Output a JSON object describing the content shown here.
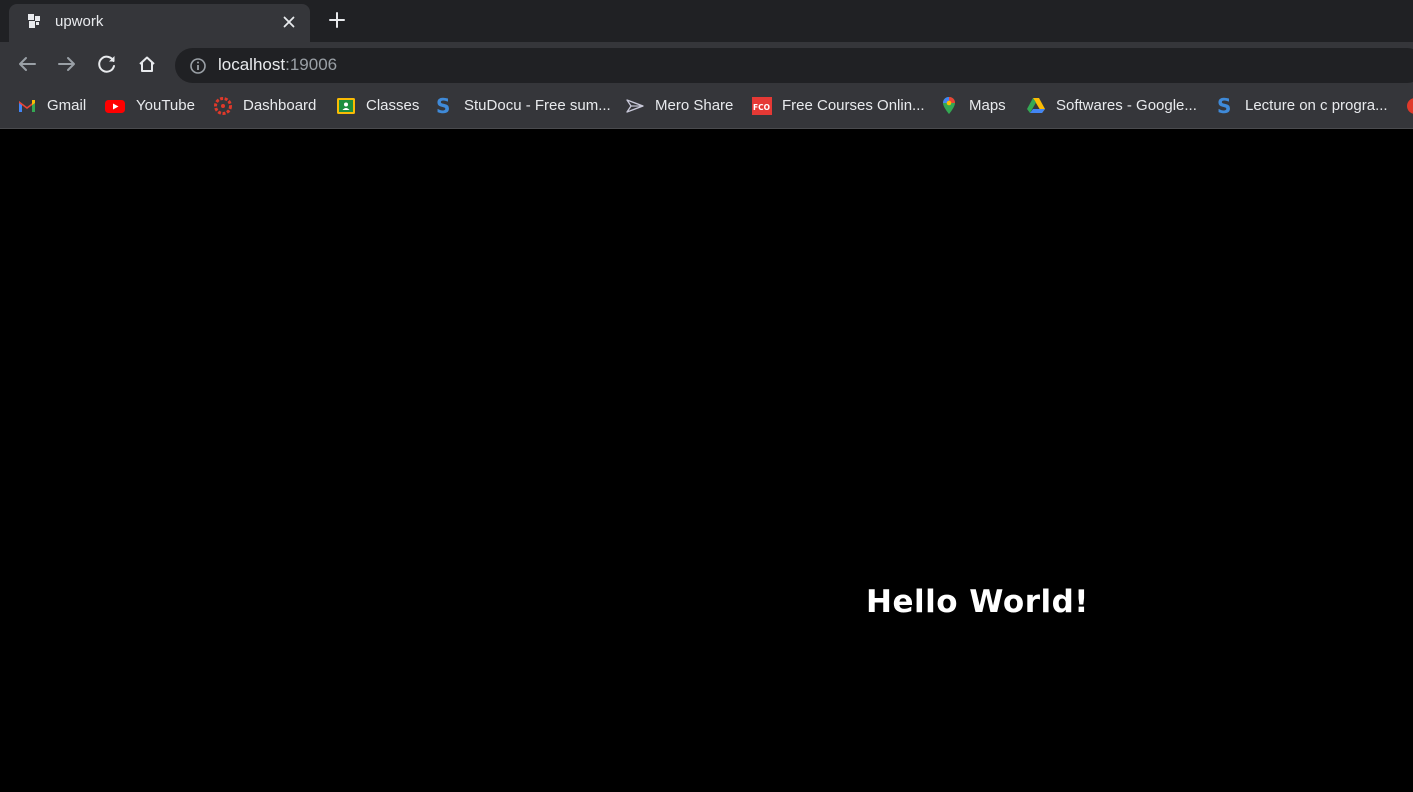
{
  "tab": {
    "title": "upwork",
    "favicon": "upwork-icon"
  },
  "omnibox": {
    "host": "localhost",
    "port": ":19006"
  },
  "bookmarks": [
    {
      "label": "Gmail",
      "icon": "gmail-icon"
    },
    {
      "label": "YouTube",
      "icon": "youtube-icon"
    },
    {
      "label": "Dashboard",
      "icon": "dashboard-icon"
    },
    {
      "label": "Classes",
      "icon": "classes-icon"
    },
    {
      "label": "StuDocu - Free sum...",
      "icon": "studocu-icon"
    },
    {
      "label": "Mero Share",
      "icon": "mero-share-icon"
    },
    {
      "label": "Free Courses Onlin...",
      "icon": "fco-icon"
    },
    {
      "label": "Maps",
      "icon": "maps-icon"
    },
    {
      "label": "Softwares - Google...",
      "icon": "google-drive-icon"
    },
    {
      "label": "Lecture on c progra...",
      "icon": "studocu-icon"
    }
  ],
  "page": {
    "text": "Hello World!"
  },
  "colors": {
    "tabstrip": "#202124",
    "toolbar": "#35363a",
    "page_background": "#000000",
    "text": "#e8eaed"
  }
}
